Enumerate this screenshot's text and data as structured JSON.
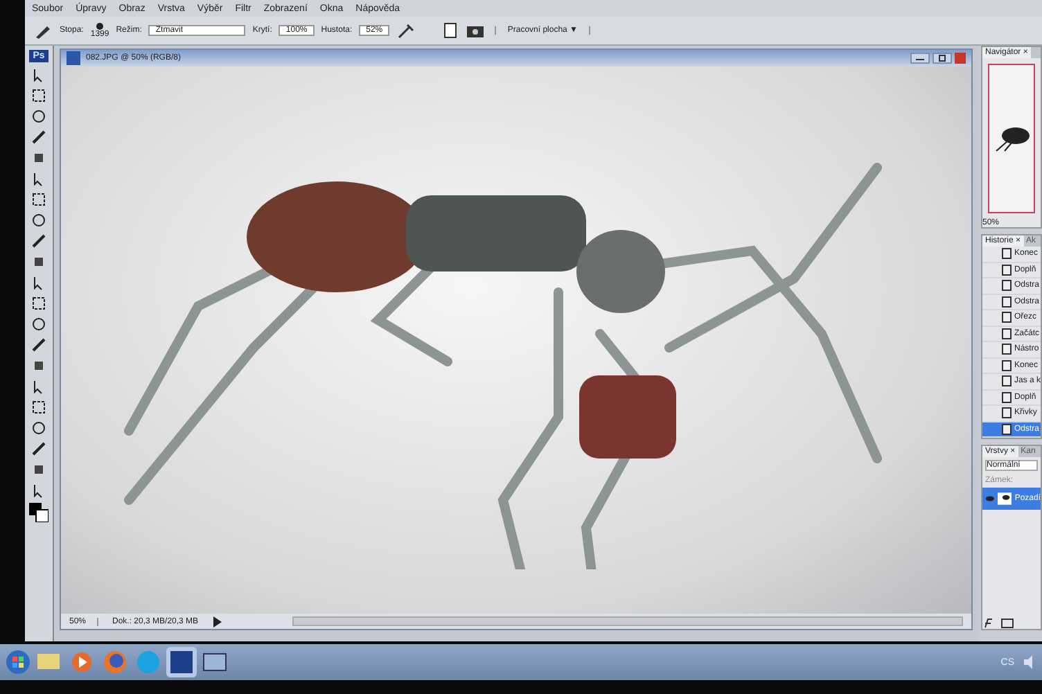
{
  "menu": [
    "Soubor",
    "Úpravy",
    "Obraz",
    "Vrstva",
    "Výběr",
    "Filtr",
    "Zobrazení",
    "Okna",
    "Nápověda"
  ],
  "options_bar": {
    "brush_label": "Stopa:",
    "brush_size": "1399",
    "mode_label": "Režim:",
    "mode": "Ztmavit",
    "opacity_label": "Krytí:",
    "opacity": "100%",
    "flow_label": "Hustota:",
    "flow": "52%",
    "workspace": "Pracovní plocha ▼"
  },
  "toolbox": {
    "logo": "Ps"
  },
  "document": {
    "title": "082.JPG @ 50% (RGB/8)",
    "zoom": "50%",
    "doc_info": "Dok.: 20,3 MB/20,3 MB"
  },
  "navigator": {
    "tabs": [
      {
        "label": "Navigátor ×",
        "selected": true
      }
    ],
    "zoom": "50%"
  },
  "history": {
    "tabs": [
      {
        "label": "Historie ×",
        "selected": true
      },
      {
        "label": "Ak",
        "selected": false
      }
    ],
    "items": [
      {
        "label": "Konec",
        "selected": false
      },
      {
        "label": "Doplň",
        "selected": false
      },
      {
        "label": "Odstra",
        "selected": false
      },
      {
        "label": "Odstra",
        "selected": false
      },
      {
        "label": "Ořezc",
        "selected": false
      },
      {
        "label": "Začátc",
        "selected": false
      },
      {
        "label": "Nástro",
        "selected": false
      },
      {
        "label": "Konec",
        "selected": false
      },
      {
        "label": "Jas a k",
        "selected": false
      },
      {
        "label": "Doplň",
        "selected": false
      },
      {
        "label": "Křivky",
        "selected": false
      },
      {
        "label": "Odstra",
        "selected": true
      }
    ]
  },
  "layers": {
    "tabs": [
      {
        "label": "Vrstvy ×",
        "selected": true
      },
      {
        "label": "Kan",
        "selected": false
      }
    ],
    "blend_mode": "Normální",
    "lock_label": "Zámek:",
    "items": [
      {
        "name": "Pozadí",
        "selected": true,
        "visible": true
      }
    ]
  },
  "taskbar": {
    "tray_text": "CS"
  }
}
